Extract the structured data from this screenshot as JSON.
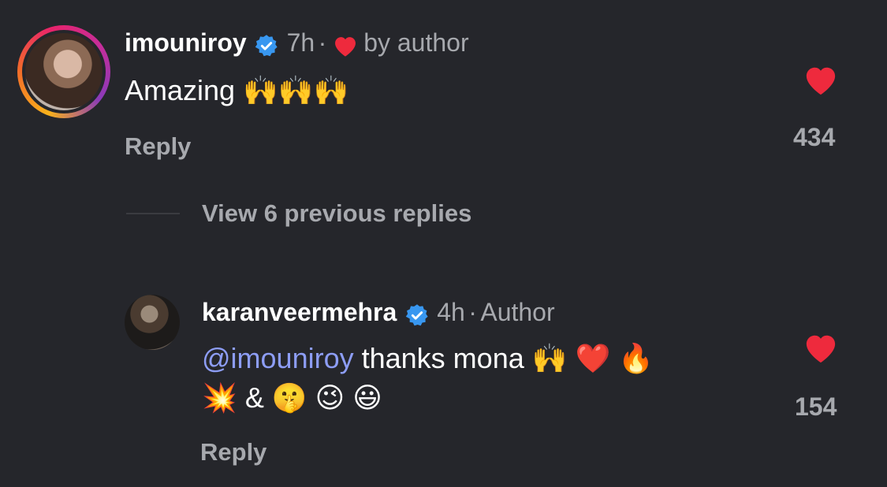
{
  "comments": [
    {
      "username": "imouniroy",
      "time": "7h",
      "separator": "·",
      "badge": "by author",
      "text": "Amazing 🙌🙌🙌",
      "reply_label": "Reply",
      "likes": "434"
    },
    {
      "username": "karanveermehra",
      "time": "4h",
      "separator": "·",
      "badge": "Author",
      "mention": "@imouniroy",
      "text_line1": " thanks mona 🙌 ❤️ 🔥",
      "text_line2": "💥 & 🤫 😉 😃",
      "reply_label": "Reply",
      "likes": "154"
    }
  ],
  "view_replies": "View 6 previous replies",
  "colors": {
    "background": "#25262b",
    "heart": "#ee2a3d",
    "verified": "#3897f0",
    "mention": "#8d9df5",
    "muted": "#a7a9ae"
  }
}
